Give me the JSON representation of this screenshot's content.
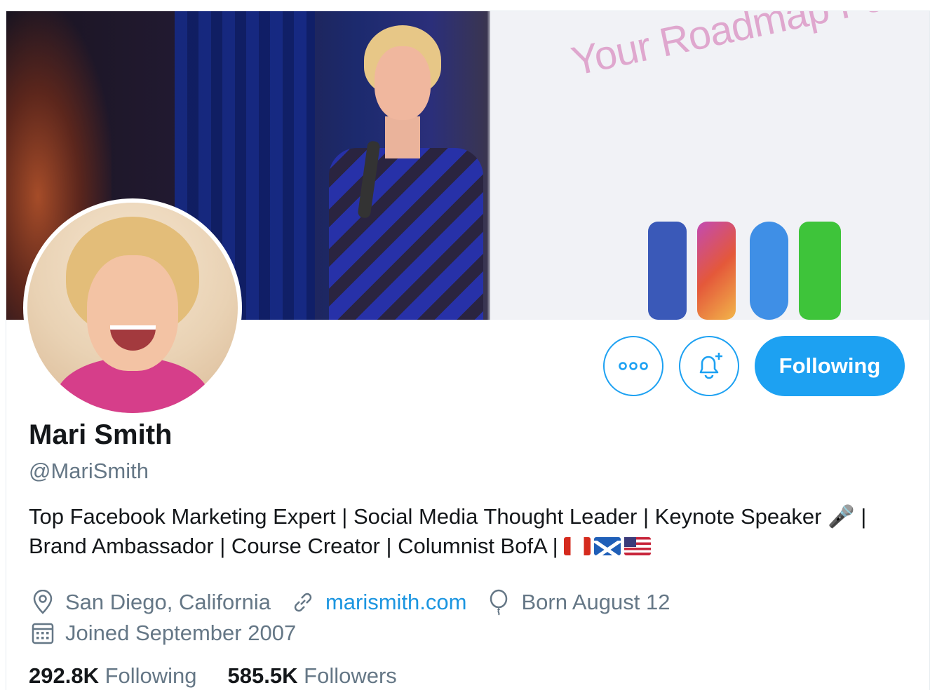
{
  "banner": {
    "screen_text": "Your Roadmap For The Futur"
  },
  "actions": {
    "more_icon": "more-horizontal-icon",
    "bell_icon": "bell-plus-icon",
    "following_label": "Following"
  },
  "profile": {
    "name": "Mari Smith",
    "handle": "@MariSmith",
    "bio_line1": "Top Facebook Marketing Expert | Social Media Thought Leader | Keynote Speaker 🎤 |",
    "bio_line2": "Brand Ambassador | Course Creator | Columnist BofA |",
    "flags": [
      "canada-flag-icon",
      "scotland-flag-icon",
      "usa-flag-icon"
    ],
    "location": "San Diego, California",
    "website": "marismith.com",
    "birthday": "Born August 12",
    "joined": "Joined September 2007"
  },
  "stats": {
    "following_count": "292.8K",
    "following_label": "Following",
    "followers_count": "585.5K",
    "followers_label": "Followers"
  },
  "colors": {
    "accent": "#1da1f2",
    "link": "#1b95e0",
    "text_primary": "#14171a",
    "text_secondary": "#657786"
  }
}
